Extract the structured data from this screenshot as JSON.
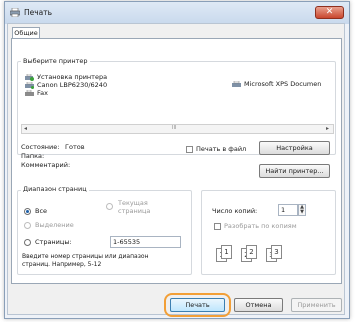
{
  "window": {
    "title": "Печать",
    "close_glyph": "✕"
  },
  "tabs": [
    {
      "label": "Общие"
    }
  ],
  "printer_section": {
    "label": "Выберите принтер",
    "printers": [
      {
        "name": "Установка принтера",
        "icon": "add-printer-icon"
      },
      {
        "name": "Microsoft XPS Documen",
        "icon": "printer-icon"
      },
      {
        "name": "Canon LBP6230/6240",
        "icon": "printer-icon",
        "selected": true
      },
      {
        "name": "Fax",
        "icon": "fax-icon"
      }
    ],
    "scroll_left": "◂",
    "scroll_right": "▸",
    "scroll_thumb": "III"
  },
  "status": {
    "state_label": "Состояние:",
    "state_value": "Готов",
    "location_label": "Папка:",
    "comment_label": "Комментарий:",
    "print_to_file_label": "Печать в файл",
    "settings_button": "Настройка",
    "find_printer_button": "Найти принтер..."
  },
  "page_range": {
    "label": "Диапазон страниц",
    "all_label": "Все",
    "selection_label": "Выделение",
    "current_page_label_1": "Текущая",
    "current_page_label_2": "страница",
    "pages_label": "Страницы:",
    "pages_value": "1-65535",
    "hint_line1": "Введите номер страницы или диапазон",
    "hint_line2": "страниц. Например, 5-12"
  },
  "copies": {
    "count_label": "Число копий:",
    "count_value": "1",
    "collate_label": "Разобрать по копиям",
    "collate_pages": [
      "1",
      "1",
      "2",
      "2",
      "3",
      "3"
    ]
  },
  "buttons": {
    "print": "Печать",
    "cancel": "Отмена",
    "apply": "Применить"
  },
  "colors": {
    "accent_highlight": "#f29f37",
    "titlebar": "#c9d9ed"
  }
}
